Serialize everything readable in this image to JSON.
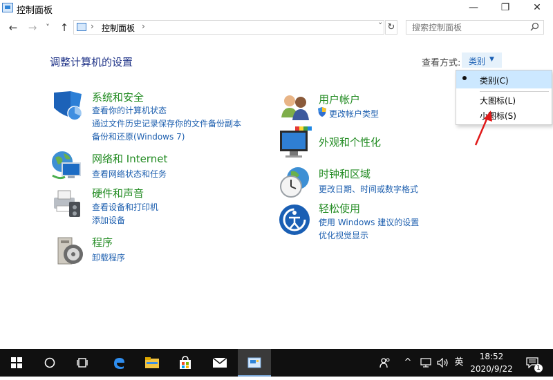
{
  "window": {
    "title": "控制面板",
    "minimize": "—",
    "maximize": "❐",
    "close": "✕"
  },
  "nav": {
    "back": "←",
    "forward": "→",
    "recent": "˅",
    "up": "↑",
    "address_sep": "›",
    "address_text": "控制面板",
    "address_dropdown": "˅",
    "refresh": "↻",
    "search_placeholder": "搜索控制面板"
  },
  "main": {
    "page_title": "调整计算机的设置",
    "view_by_label": "查看方式:",
    "view_by_value": "类别"
  },
  "categories": [
    {
      "title": "系统和安全",
      "links": [
        "查看你的计算机状态",
        "通过文件历史记录保存你的文件备份副本",
        "备份和还原(Windows 7)"
      ]
    },
    {
      "title": "网络和 Internet",
      "links": [
        "查看网络状态和任务"
      ]
    },
    {
      "title": "硬件和声音",
      "links": [
        "查看设备和打印机",
        "添加设备"
      ]
    },
    {
      "title": "程序",
      "links": [
        "卸载程序"
      ]
    },
    {
      "title": "用户帐户",
      "links": [
        "更改帐户类型"
      ]
    },
    {
      "title": "外观和个性化",
      "links": []
    },
    {
      "title": "时钟和区域",
      "links": [
        "更改日期、时间或数字格式"
      ]
    },
    {
      "title": "轻松使用",
      "links": [
        "使用 Windows 建议的设置",
        "优化视觉显示"
      ]
    }
  ],
  "menu": {
    "items": [
      {
        "label": "类别(C)",
        "selected": true
      },
      {
        "label": "大图标(L)",
        "selected": false
      },
      {
        "label": "小图标(S)",
        "selected": false
      }
    ]
  },
  "taskbar": {
    "tray_lang": "英",
    "time": "18:52",
    "date": "2020/9/22",
    "notification_count": "1"
  },
  "colors": {
    "category_title": "#228b22",
    "link": "#1d5faf",
    "taskbar": "#101010",
    "menu_selected": "#cce8ff",
    "annotation_arrow": "#e01818"
  }
}
